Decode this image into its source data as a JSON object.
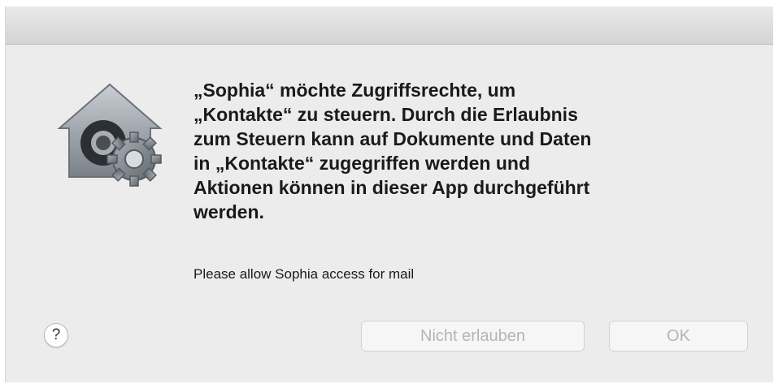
{
  "dialog": {
    "message": "„Sophia“ möchte Zugriffsrechte, um\n„Kontakte“ zu steuern. Durch die Erlaubnis\nzum Steuern kann auf Dokumente und Daten\nin „Kontakte“ zugegriffen werden und\nAktionen können in dieser App durchgeführt\nwerden.",
    "info": "Please allow Sophia access for mail",
    "help_label": "?",
    "deny_label": "Nicht erlauben",
    "ok_label": "OK",
    "icon": "security-house-gear-icon",
    "colors": {
      "background": "#ececec",
      "disabled_text": "#b5b5b5",
      "text": "#1a1a1a"
    }
  }
}
